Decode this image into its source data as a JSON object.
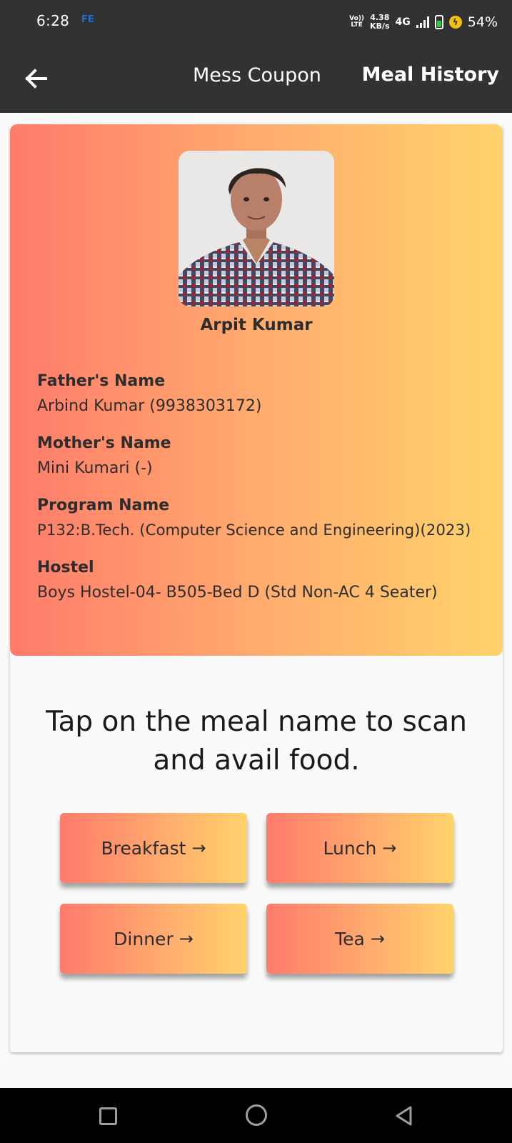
{
  "status_bar": {
    "time": "6:28",
    "carrier_badge": "FE",
    "volte_top": "Vo))",
    "volte_bottom": "LTE",
    "speed_value": "4.38",
    "speed_unit": "KB/s",
    "network": "4G",
    "battery": "54%",
    "icons": [
      "signal-icon",
      "battery-icon",
      "charging-icon"
    ]
  },
  "app_bar": {
    "title": "Mess Coupon",
    "action": "Meal History",
    "back_icon": "arrow-left-icon"
  },
  "profile": {
    "name": "Arpit Kumar",
    "fields": [
      {
        "label": "Father's Name",
        "value": "Arbind Kumar (9938303172)"
      },
      {
        "label": "Mother's Name",
        "value": "Mini Kumari (-)"
      },
      {
        "label": "Program Name",
        "value": "P132:B.Tech. (Computer Science and Engineering)(2023)"
      },
      {
        "label": "Hostel",
        "value": "Boys Hostel-04- B505-Bed D (Std Non-AC 4 Seater)"
      }
    ]
  },
  "instruction": {
    "line1": "Tap on the meal name to scan",
    "line2": "and avail food."
  },
  "meals": [
    {
      "label": "Breakfast",
      "arrow": "→"
    },
    {
      "label": "Lunch",
      "arrow": "→"
    },
    {
      "label": "Dinner",
      "arrow": "→"
    },
    {
      "label": "Tea",
      "arrow": "→"
    }
  ],
  "colors": {
    "header_bg": "#323232",
    "gradient_start": "#ff7b6b",
    "gradient_end": "#ffd36b",
    "text_dark": "#2d2d2d"
  },
  "nav_bar": {
    "icons": [
      "recent-apps-icon",
      "home-icon",
      "back-triangle-icon"
    ]
  }
}
